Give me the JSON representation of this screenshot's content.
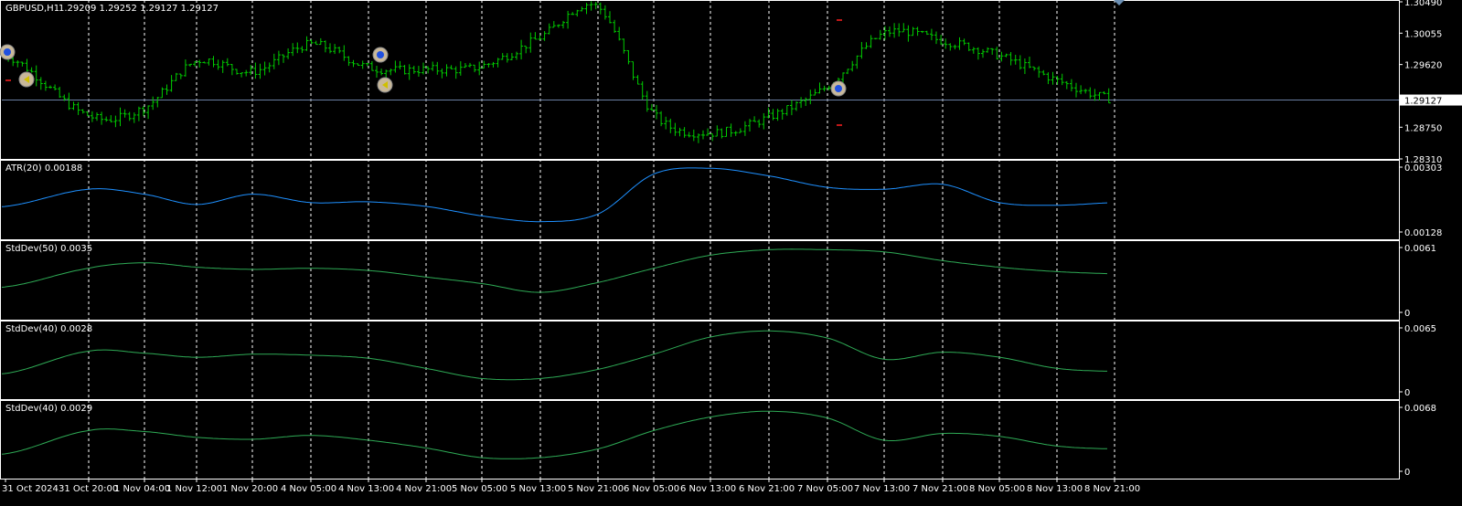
{
  "main": {
    "symbol_label": "GBPUSD,H1",
    "ohlc_label": "1.29209 1.29252 1.29127 1.29127",
    "price_ticks": [
      "1.30490",
      "1.30055",
      "1.29620",
      "1.28750",
      "1.28310"
    ],
    "current_price": "1.29127"
  },
  "indicators": [
    {
      "label": "ATR(20) 0.00188",
      "max_label": "0.00303",
      "min_label": "0.00128"
    },
    {
      "label": "StdDev(50) 0.0035",
      "max_label": "0.0061",
      "min_label": "0"
    },
    {
      "label": "StdDev(40) 0.0028",
      "max_label": "0.0065",
      "min_label": "0"
    },
    {
      "label": "StdDev(40) 0.0029",
      "max_label": "0.0068",
      "min_label": "0"
    }
  ],
  "time_labels": [
    "31 Oct 2024",
    "31 Oct 20:00",
    "1 Nov 04:00",
    "1 Nov 12:00",
    "1 Nov 20:00",
    "4 Nov 05:00",
    "4 Nov 13:00",
    "4 Nov 21:00",
    "5 Nov 05:00",
    "5 Nov 13:00",
    "5 Nov 21:00",
    "6 Nov 05:00",
    "6 Nov 13:00",
    "6 Nov 21:00",
    "7 Nov 05:00",
    "7 Nov 13:00",
    "7 Nov 21:00",
    "8 Nov 05:00",
    "8 Nov 13:00",
    "8 Nov 21:00"
  ],
  "colors": {
    "background": "#000000",
    "bars": "#00cc00",
    "atr_line": "#1e90ff",
    "stddev_line": "#2eaa55",
    "grid_divider": "#ffffff",
    "price_line": "#6b7fa3",
    "marker_red": "#ff2020"
  },
  "chart_data": {
    "type": "line",
    "x": [
      "31 Oct 2024",
      "31 Oct 20:00",
      "1 Nov 04:00",
      "1 Nov 12:00",
      "1 Nov 20:00",
      "4 Nov 05:00",
      "4 Nov 13:00",
      "4 Nov 21:00",
      "5 Nov 05:00",
      "5 Nov 13:00",
      "5 Nov 21:00",
      "6 Nov 05:00",
      "6 Nov 13:00",
      "6 Nov 21:00",
      "7 Nov 05:00",
      "7 Nov 13:00",
      "7 Nov 21:00",
      "8 Nov 05:00",
      "8 Nov 13:00",
      "8 Nov 21:00"
    ],
    "series": [
      {
        "name": "GBPUSD,H1",
        "values": [
          1.2975,
          1.2891,
          1.2902,
          1.2967,
          1.2952,
          1.299,
          1.2958,
          1.2955,
          1.296,
          1.3,
          1.3042,
          1.2893,
          1.2867,
          1.2889,
          1.2932,
          1.3005,
          1.2995,
          1.2974,
          1.294,
          1.2913
        ]
      },
      {
        "name": "ATR(20)",
        "values": [
          0.002,
          0.00245,
          0.00232,
          0.00205,
          0.00232,
          0.0021,
          0.00212,
          0.002,
          0.00175,
          0.0016,
          0.0018,
          0.00285,
          0.003,
          0.0028,
          0.0025,
          0.00245,
          0.00258,
          0.0021,
          0.00203,
          0.0021
        ]
      },
      {
        "name": "StdDev(50)",
        "values": [
          0.0025,
          0.0042,
          0.0047,
          0.0043,
          0.0041,
          0.0042,
          0.004,
          0.0034,
          0.0028,
          0.002,
          0.0029,
          0.0042,
          0.0054,
          0.0059,
          0.0059,
          0.0057,
          0.0049,
          0.0043,
          0.0039,
          0.0037
        ]
      },
      {
        "name": "StdDev(40)",
        "values": [
          0.002,
          0.0042,
          0.004,
          0.0036,
          0.0039,
          0.0038,
          0.0035,
          0.0025,
          0.0015,
          0.0015,
          0.0024,
          0.0039,
          0.0056,
          0.0062,
          0.0055,
          0.0034,
          0.0041,
          0.0036,
          0.0025,
          0.0022
        ]
      },
      {
        "name": "StdDev(40)",
        "values": [
          0.002,
          0.0044,
          0.0043,
          0.0037,
          0.0035,
          0.0039,
          0.0034,
          0.0026,
          0.0016,
          0.0016,
          0.0025,
          0.0044,
          0.0058,
          0.0064,
          0.0057,
          0.0034,
          0.0041,
          0.0038,
          0.0028,
          0.0025
        ]
      }
    ],
    "ylim": [
      [
        1.2831,
        1.3049
      ],
      [
        0.00128,
        0.00303
      ],
      [
        0,
        0.0061
      ],
      [
        0,
        0.0065
      ],
      [
        0,
        0.0068
      ]
    ]
  }
}
